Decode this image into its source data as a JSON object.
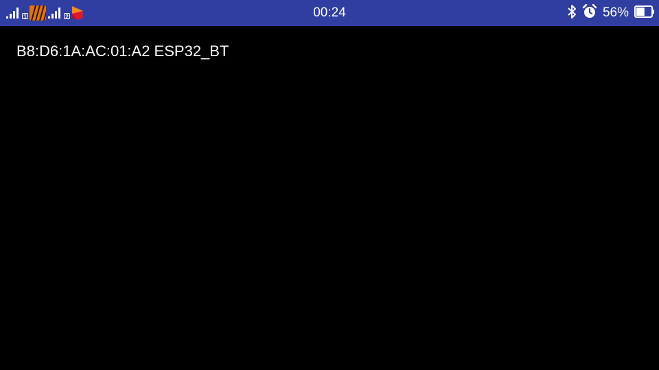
{
  "status_bar": {
    "time": "00:24",
    "battery_percent": "56%",
    "battery_level": 0.56,
    "sim1_label": "1",
    "sim2_label": "2",
    "background_color": "#2f3ea0",
    "icons": [
      "signal-icon",
      "sim-1-badge",
      "app-notification-icon",
      "signal-icon",
      "sim-2-badge",
      "app-notification-icon",
      "bluetooth-icon",
      "alarm-icon",
      "battery-icon"
    ]
  },
  "device_list": {
    "items": [
      {
        "label": "B8:D6:1A:AC:01:A2 ESP32_BT"
      }
    ]
  }
}
